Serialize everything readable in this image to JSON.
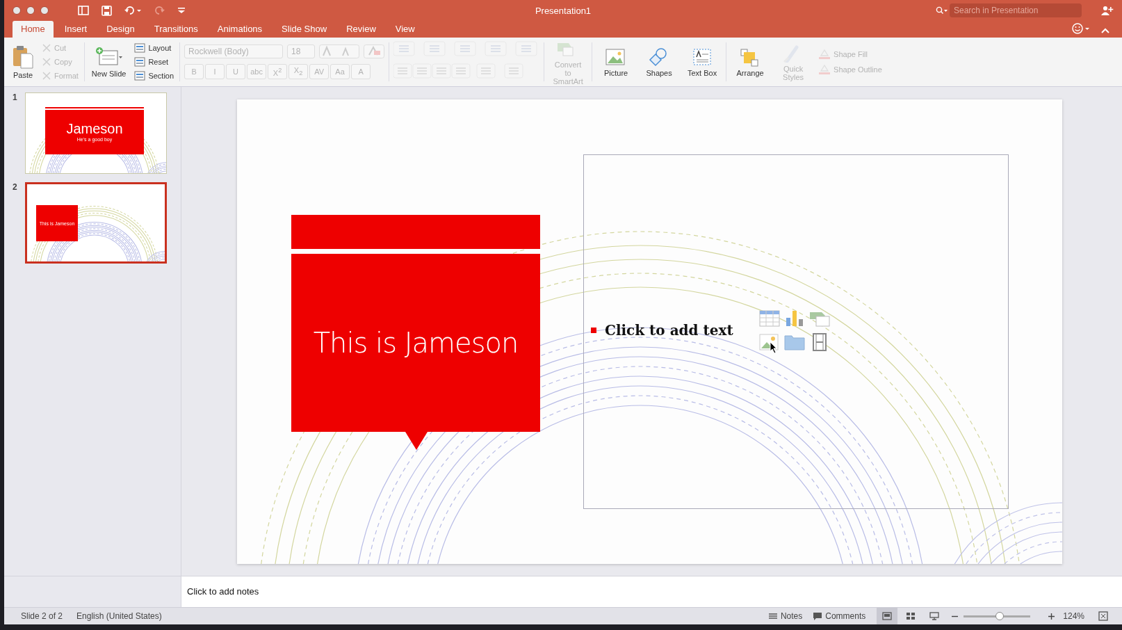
{
  "window": {
    "title": "Presentation1",
    "search": {
      "placeholder": "Search in Presentation"
    }
  },
  "tabs": [
    {
      "label": "Home",
      "selected": true
    },
    {
      "label": "Insert",
      "selected": false
    },
    {
      "label": "Design",
      "selected": false
    },
    {
      "label": "Transitions",
      "selected": false
    },
    {
      "label": "Animations",
      "selected": false
    },
    {
      "label": "Slide Show",
      "selected": false
    },
    {
      "label": "Review",
      "selected": false
    },
    {
      "label": "View",
      "selected": false
    }
  ],
  "ribbon": {
    "paste": {
      "label": "Paste",
      "disabled": false
    },
    "clipboard": [
      {
        "label": "Cut",
        "disabled": true
      },
      {
        "label": "Copy",
        "disabled": true
      },
      {
        "label": "Format",
        "disabled": true
      }
    ],
    "new_slide": {
      "label": "New Slide",
      "disabled": false
    },
    "slide_tools": [
      {
        "label": "Layout",
        "disabled": false
      },
      {
        "label": "Reset",
        "disabled": false
      },
      {
        "label": "Section",
        "disabled": false
      }
    ],
    "font": {
      "disabled": true,
      "font_name": "Rockwell (Body)",
      "font_size": "18",
      "format_buttons": [
        "B",
        "I",
        "U",
        "abc",
        "X$^{2}$",
        "X$_{2}$",
        "AV",
        "Aa",
        "A"
      ]
    },
    "paragraph": {
      "disabled": true
    },
    "large_buttons": [
      {
        "label": "Convert to SmartArt",
        "disabled": true
      },
      {
        "label": "Picture",
        "disabled": false
      },
      {
        "label": "Shapes",
        "disabled": false
      },
      {
        "label": "Text Box",
        "disabled": false
      },
      {
        "label": "Arrange",
        "disabled": false
      },
      {
        "label": "Quick Styles",
        "disabled": true
      }
    ],
    "shape_tools": [
      {
        "label": "Shape Fill",
        "disabled": true
      },
      {
        "label": "Shape Outline",
        "disabled": true
      }
    ]
  },
  "slides": [
    {
      "number": "1",
      "selected": false,
      "title": "Jameson",
      "subtitle": "He's a good boy"
    },
    {
      "number": "2",
      "selected": true,
      "title": "This is Jameson"
    }
  ],
  "slide": {
    "callout_text": "This is Jameson",
    "content_placeholder": "Click to add text"
  },
  "notes": {
    "placeholder": "Click to add notes"
  },
  "status_bar": {
    "slide_position": "Slide 2 of 2",
    "language": "English (United States)",
    "notes_label": "Notes",
    "comments_label": "Comments",
    "views": [
      {
        "selected": true
      },
      {
        "selected": false
      },
      {
        "selected": false
      }
    ],
    "zoom": {
      "level": 0.54,
      "reading": "124%"
    }
  }
}
